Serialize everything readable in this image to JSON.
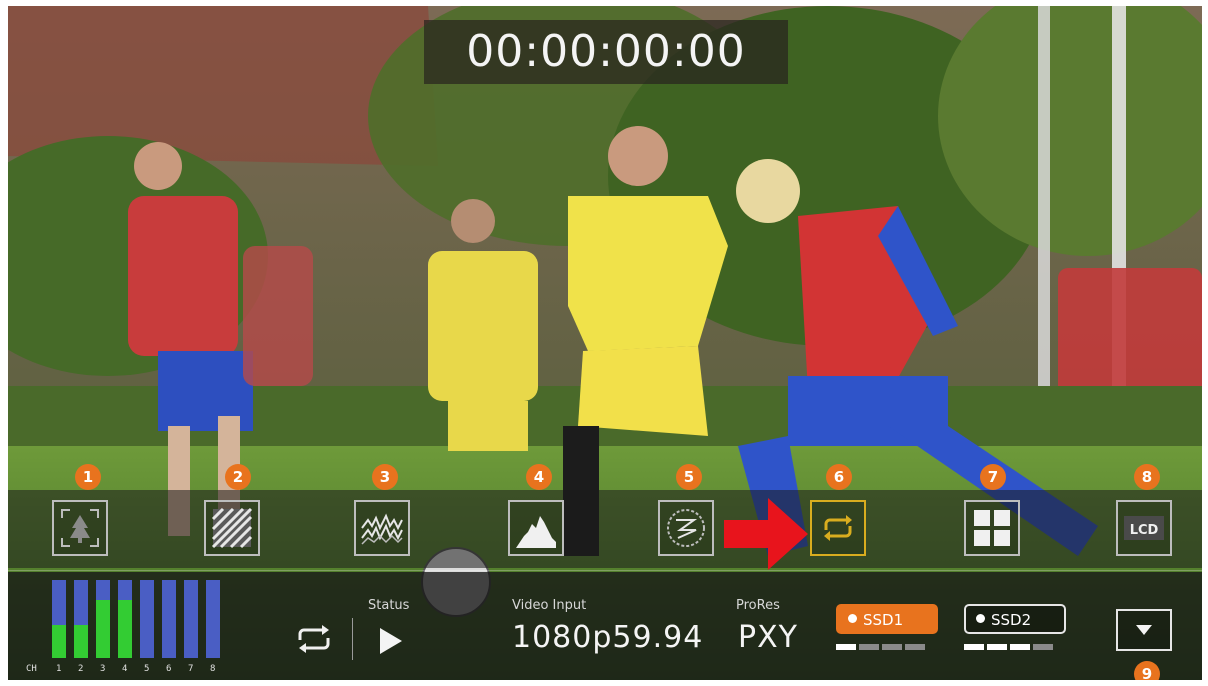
{
  "timecode": "00:00:00:00",
  "toolbar": {
    "numbers": [
      "1",
      "2",
      "3",
      "4",
      "5",
      "6",
      "7",
      "8",
      "9"
    ],
    "buttons": [
      {
        "icon": "focus-peaking-icon"
      },
      {
        "icon": "zebra-icon"
      },
      {
        "icon": "waveform-icon"
      },
      {
        "icon": "histogram-icon"
      },
      {
        "icon": "anamorphic-icon"
      },
      {
        "icon": "loop-icon",
        "active": true
      },
      {
        "icon": "grid-layout-icon"
      },
      {
        "icon": "lcd-icon",
        "label": "LCD"
      }
    ]
  },
  "audio_meter": {
    "prefix": "CH",
    "channels": [
      "1",
      "2",
      "3",
      "4",
      "5",
      "6",
      "7",
      "8"
    ],
    "green_levels": [
      0.42,
      0.42,
      0.75,
      0.75,
      0,
      0,
      0,
      0
    ]
  },
  "status": {
    "label": "Status"
  },
  "video_input": {
    "label": "Video Input",
    "value": "1080p59.94"
  },
  "codec": {
    "label": "ProRes",
    "value": "PXY"
  },
  "ssd1": {
    "label": "SSD1",
    "fill_segments": 1,
    "total_segments": 4
  },
  "ssd2": {
    "label": "SSD2",
    "fill_segments": 3,
    "total_segments": 4
  },
  "colors": {
    "accent": "#e8731e",
    "active_border": "#d9ad1f",
    "meter_blue": "#4a5ec4",
    "meter_green": "#33cc33",
    "arrow": "#e8141c"
  }
}
